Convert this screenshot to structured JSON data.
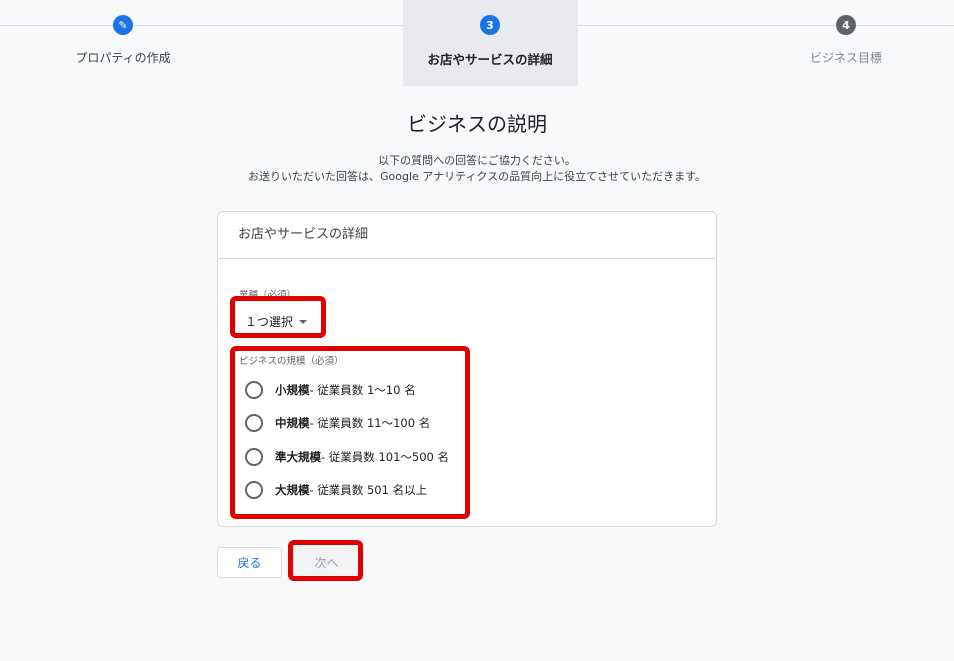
{
  "stepper": {
    "steps": [
      {
        "marker": "✎",
        "label": "プロパティの作成",
        "color": "#1a73e8"
      },
      {
        "marker": "3",
        "label": "お店やサービスの詳細",
        "color": "#1a73e8"
      },
      {
        "marker": "4",
        "label": "ビジネス目標",
        "color": "#5f6368"
      }
    ]
  },
  "page": {
    "title": "ビジネスの説明",
    "subtitle_line1": "以下の質問への回答にご協力ください。",
    "subtitle_line2": "お送りいただいた回答は、Google アナリティクスの品質向上に役立てさせていただきます。"
  },
  "card": {
    "header": "お店やサービスの詳細",
    "industry": {
      "label": "業種（必須）",
      "value": "１つ選択"
    },
    "size": {
      "label": "ビジネスの規模（必須）",
      "options": [
        {
          "name": "小規模",
          "detail": " - 従業員数 1〜10 名"
        },
        {
          "name": "中規模",
          "detail": " - 従業員数 11〜100 名"
        },
        {
          "name": "準大規模",
          "detail": " - 従業員数 101〜500 名"
        },
        {
          "name": "大規模",
          "detail": " - 従業員数 501 名以上"
        }
      ]
    }
  },
  "buttons": {
    "back": "戻る",
    "next": "次へ"
  },
  "colors": {
    "accent": "#1a73e8",
    "highlight": "#e00000",
    "inactive_step": "#5f6368"
  }
}
